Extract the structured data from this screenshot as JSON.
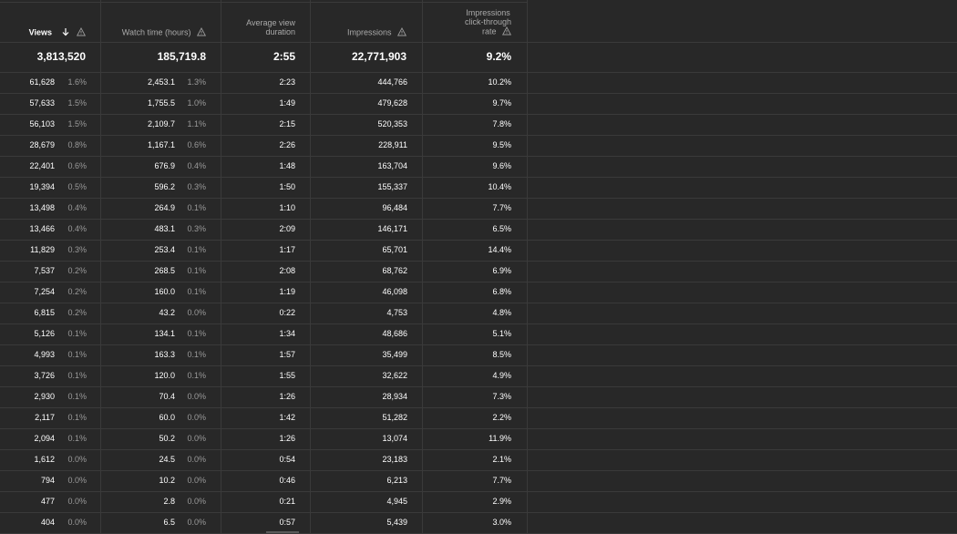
{
  "headers": {
    "views": "Views",
    "watch_time": "Watch time (hours)",
    "avg_view_duration_line1": "Average view",
    "avg_view_duration_line2": "duration",
    "impressions": "Impressions",
    "ctr_line1": "Impressions",
    "ctr_line2": "click-through",
    "ctr_line3": "rate"
  },
  "icons": {
    "sort": "arrow-down-icon",
    "warning": "warning-triangle-icon"
  },
  "totals": {
    "views": "3,813,520",
    "watch_time": "185,719.8",
    "avg_view_duration": "2:55",
    "impressions": "22,771,903",
    "ctr": "9.2%"
  },
  "rows": [
    {
      "views": "61,628",
      "views_pct": "1.6%",
      "watch": "2,453.1",
      "watch_pct": "1.3%",
      "avd": "2:23",
      "impr": "444,766",
      "ctr": "10.2%"
    },
    {
      "views": "57,633",
      "views_pct": "1.5%",
      "watch": "1,755.5",
      "watch_pct": "1.0%",
      "avd": "1:49",
      "impr": "479,628",
      "ctr": "9.7%"
    },
    {
      "views": "56,103",
      "views_pct": "1.5%",
      "watch": "2,109.7",
      "watch_pct": "1.1%",
      "avd": "2:15",
      "impr": "520,353",
      "ctr": "7.8%"
    },
    {
      "views": "28,679",
      "views_pct": "0.8%",
      "watch": "1,167.1",
      "watch_pct": "0.6%",
      "avd": "2:26",
      "impr": "228,911",
      "ctr": "9.5%"
    },
    {
      "views": "22,401",
      "views_pct": "0.6%",
      "watch": "676.9",
      "watch_pct": "0.4%",
      "avd": "1:48",
      "impr": "163,704",
      "ctr": "9.6%"
    },
    {
      "views": "19,394",
      "views_pct": "0.5%",
      "watch": "596.2",
      "watch_pct": "0.3%",
      "avd": "1:50",
      "impr": "155,337",
      "ctr": "10.4%"
    },
    {
      "views": "13,498",
      "views_pct": "0.4%",
      "watch": "264.9",
      "watch_pct": "0.1%",
      "avd": "1:10",
      "impr": "96,484",
      "ctr": "7.7%"
    },
    {
      "views": "13,466",
      "views_pct": "0.4%",
      "watch": "483.1",
      "watch_pct": "0.3%",
      "avd": "2:09",
      "impr": "146,171",
      "ctr": "6.5%"
    },
    {
      "views": "11,829",
      "views_pct": "0.3%",
      "watch": "253.4",
      "watch_pct": "0.1%",
      "avd": "1:17",
      "impr": "65,701",
      "ctr": "14.4%"
    },
    {
      "views": "7,537",
      "views_pct": "0.2%",
      "watch": "268.5",
      "watch_pct": "0.1%",
      "avd": "2:08",
      "impr": "68,762",
      "ctr": "6.9%"
    },
    {
      "views": "7,254",
      "views_pct": "0.2%",
      "watch": "160.0",
      "watch_pct": "0.1%",
      "avd": "1:19",
      "impr": "46,098",
      "ctr": "6.8%"
    },
    {
      "views": "6,815",
      "views_pct": "0.2%",
      "watch": "43.2",
      "watch_pct": "0.0%",
      "avd": "0:22",
      "impr": "4,753",
      "ctr": "4.8%"
    },
    {
      "views": "5,126",
      "views_pct": "0.1%",
      "watch": "134.1",
      "watch_pct": "0.1%",
      "avd": "1:34",
      "impr": "48,686",
      "ctr": "5.1%"
    },
    {
      "views": "4,993",
      "views_pct": "0.1%",
      "watch": "163.3",
      "watch_pct": "0.1%",
      "avd": "1:57",
      "impr": "35,499",
      "ctr": "8.5%"
    },
    {
      "views": "3,726",
      "views_pct": "0.1%",
      "watch": "120.0",
      "watch_pct": "0.1%",
      "avd": "1:55",
      "impr": "32,622",
      "ctr": "4.9%"
    },
    {
      "views": "2,930",
      "views_pct": "0.1%",
      "watch": "70.4",
      "watch_pct": "0.0%",
      "avd": "1:26",
      "impr": "28,934",
      "ctr": "7.3%"
    },
    {
      "views": "2,117",
      "views_pct": "0.1%",
      "watch": "60.0",
      "watch_pct": "0.0%",
      "avd": "1:42",
      "impr": "51,282",
      "ctr": "2.2%"
    },
    {
      "views": "2,094",
      "views_pct": "0.1%",
      "watch": "50.2",
      "watch_pct": "0.0%",
      "avd": "1:26",
      "impr": "13,074",
      "ctr": "11.9%"
    },
    {
      "views": "1,612",
      "views_pct": "0.0%",
      "watch": "24.5",
      "watch_pct": "0.0%",
      "avd": "0:54",
      "impr": "23,183",
      "ctr": "2.1%"
    },
    {
      "views": "794",
      "views_pct": "0.0%",
      "watch": "10.2",
      "watch_pct": "0.0%",
      "avd": "0:46",
      "impr": "6,213",
      "ctr": "7.7%"
    },
    {
      "views": "477",
      "views_pct": "0.0%",
      "watch": "2.8",
      "watch_pct": "0.0%",
      "avd": "0:21",
      "impr": "4,945",
      "ctr": "2.9%"
    },
    {
      "views": "404",
      "views_pct": "0.0%",
      "watch": "6.5",
      "watch_pct": "0.0%",
      "avd": "0:57",
      "impr": "5,439",
      "ctr": "3.0%"
    }
  ]
}
